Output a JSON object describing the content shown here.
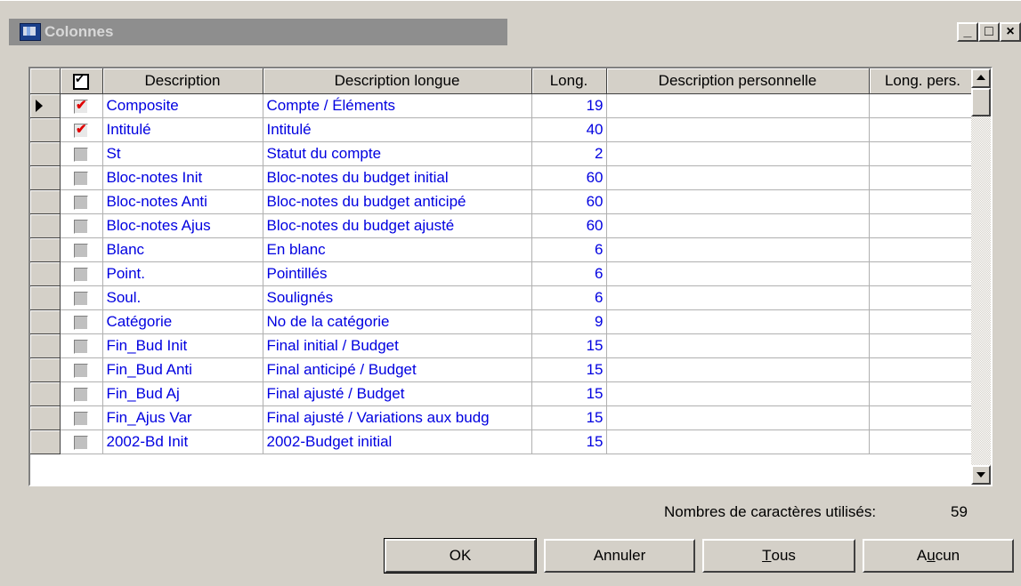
{
  "window": {
    "title": "Colonnes",
    "min_label": "_",
    "max_label": "□",
    "close_label": "×"
  },
  "grid": {
    "columns": [
      "Description",
      "Description longue",
      "Long.",
      "Description personnelle",
      "Long. pers."
    ],
    "rows": [
      {
        "checked": true,
        "desc": "Composite",
        "long_desc": "Compte / Éléments",
        "len": "19",
        "pers": "",
        "len_pers": ""
      },
      {
        "checked": true,
        "desc": "Intitulé",
        "long_desc": "Intitulé",
        "len": "40",
        "pers": "",
        "len_pers": ""
      },
      {
        "checked": false,
        "desc": "St",
        "long_desc": "Statut du compte",
        "len": "2",
        "pers": "",
        "len_pers": ""
      },
      {
        "checked": false,
        "desc": "Bloc-notes Init",
        "long_desc": "Bloc-notes du budget initial",
        "len": "60",
        "pers": "",
        "len_pers": ""
      },
      {
        "checked": false,
        "desc": "Bloc-notes Anti",
        "long_desc": "Bloc-notes du budget anticipé",
        "len": "60",
        "pers": "",
        "len_pers": ""
      },
      {
        "checked": false,
        "desc": "Bloc-notes Ajus",
        "long_desc": "Bloc-notes du budget ajusté",
        "len": "60",
        "pers": "",
        "len_pers": ""
      },
      {
        "checked": false,
        "desc": "Blanc",
        "long_desc": "En blanc",
        "len": "6",
        "pers": "",
        "len_pers": ""
      },
      {
        "checked": false,
        "desc": "Point.",
        "long_desc": "Pointillés",
        "len": "6",
        "pers": "",
        "len_pers": ""
      },
      {
        "checked": false,
        "desc": "Soul.",
        "long_desc": "Soulignés",
        "len": "6",
        "pers": "",
        "len_pers": ""
      },
      {
        "checked": false,
        "desc": "Catégorie",
        "long_desc": "No de la catégorie",
        "len": "9",
        "pers": "",
        "len_pers": ""
      },
      {
        "checked": false,
        "desc": "Fin_Bud Init",
        "long_desc": "Final initial / Budget",
        "len": "15",
        "pers": "",
        "len_pers": ""
      },
      {
        "checked": false,
        "desc": "Fin_Bud Anti",
        "long_desc": "Final anticipé / Budget",
        "len": "15",
        "pers": "",
        "len_pers": ""
      },
      {
        "checked": false,
        "desc": "Fin_Bud Aj",
        "long_desc": "Final ajusté / Budget",
        "len": "15",
        "pers": "",
        "len_pers": ""
      },
      {
        "checked": false,
        "desc": "Fin_Ajus Var",
        "long_desc": "Final ajusté / Variations aux budg",
        "len": "15",
        "pers": "",
        "len_pers": ""
      },
      {
        "checked": false,
        "desc": "2002-Bd Init",
        "long_desc": "2002-Budget initial",
        "len": "15",
        "pers": "",
        "len_pers": ""
      }
    ]
  },
  "footer": {
    "count_label": "Nombres de caractères utilisés:",
    "count_value": "59"
  },
  "buttons": {
    "ok": "OK",
    "cancel": "Annuler",
    "all_prefix": "",
    "all_mnemonic": "T",
    "all_rest": "ous",
    "none_prefix": "A",
    "none_mnemonic": "u",
    "none_rest": "cun"
  },
  "colors": {
    "face": "#d4d0c8",
    "cell_text": "#0000e0",
    "check_mark": "#e00000"
  }
}
